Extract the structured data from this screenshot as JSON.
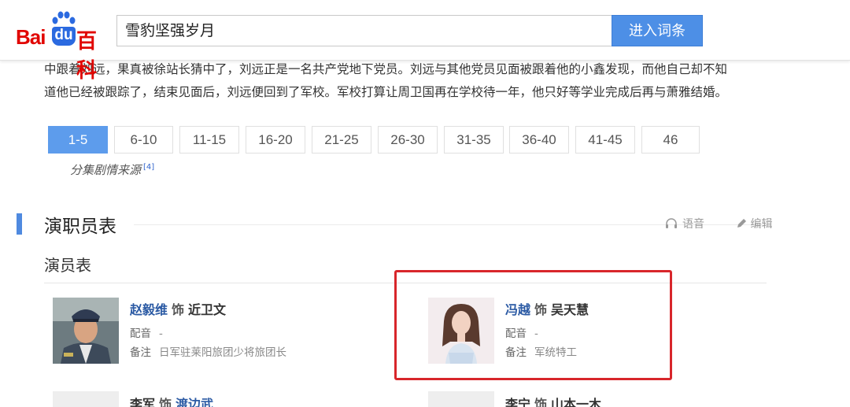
{
  "header": {
    "logo": {
      "bai": "Bai",
      "du": "du",
      "baike": "百科"
    },
    "search_value": "雪豹坚强岁月",
    "enter_button": "进入词条"
  },
  "summary": {
    "line1": "中跟着刘远，果真被徐站长猜中了，刘远正是一名共产党地下党员。刘远与其他党员见面被跟着他的小鑫发现，而他自己却不知",
    "line2": "道他已经被跟踪了，结束见面后，刘远便回到了军校。军校打算让周卫国再在学校待一年，他只好等学业完成后再与萧雅结婚。"
  },
  "pager": {
    "pages": [
      "1-5",
      "6-10",
      "11-15",
      "16-20",
      "21-25",
      "26-30",
      "31-35",
      "36-40",
      "41-45",
      "46"
    ],
    "active_index": 0,
    "source_label": "分集剧情来源",
    "source_ref": "[4]"
  },
  "section": {
    "title": "演职员表",
    "voice_label": "语音",
    "edit_label": "编辑",
    "subtitle": "演员表"
  },
  "cast": [
    {
      "actor": "赵毅维",
      "as": "饰",
      "role": "近卫文",
      "dub_key": "配音",
      "dub_val": "-",
      "note_key": "备注",
      "note_val": "日军驻莱阳旅团少将旅团长"
    },
    {
      "actor": "冯越",
      "as": "饰",
      "role": "吴天慧",
      "dub_key": "配音",
      "dub_val": "-",
      "note_key": "备注",
      "note_val": "军统特工"
    },
    {
      "actor": "李军",
      "as": "饰",
      "role": "渡边武"
    },
    {
      "actor": "李宁",
      "as": "饰",
      "role": "山本一木"
    }
  ],
  "colors": {
    "accent": "#4d8fe6",
    "link": "#2b5aa4",
    "highlight": "#d8262b",
    "brand": "#e10602"
  }
}
